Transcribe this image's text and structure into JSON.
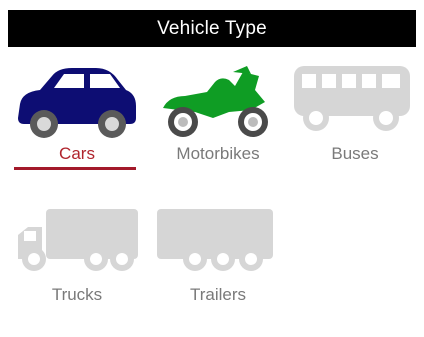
{
  "header": {
    "title": "Vehicle Type"
  },
  "vehicles": [
    {
      "label": "Cars",
      "icon": "car-icon",
      "selected": true,
      "color": "#0d0d73"
    },
    {
      "label": "Motorbikes",
      "icon": "motorbike-icon",
      "selected": false,
      "color": "#0f9d24"
    },
    {
      "label": "Buses",
      "icon": "bus-icon",
      "selected": false,
      "color": "#d6d6d6"
    },
    {
      "label": "Trucks",
      "icon": "truck-icon",
      "selected": false,
      "color": "#d6d6d6"
    },
    {
      "label": "Trailers",
      "icon": "trailer-icon",
      "selected": false,
      "color": "#d6d6d6"
    }
  ],
  "colors": {
    "selected_underline": "#a3192a",
    "label_default": "#7a7a7a",
    "label_selected": "#b0242d",
    "inactive_icon": "#d6d6d6"
  }
}
